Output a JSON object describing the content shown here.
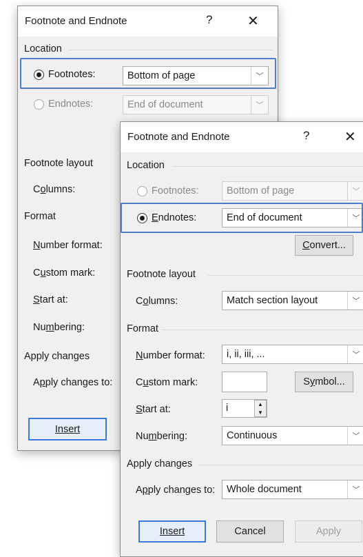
{
  "back_dialog": {
    "title": "Footnote and Endnote",
    "help": "?",
    "close": "✕",
    "location_header": "Location",
    "footnotes_label": "Footnotes:",
    "footnotes_value": "Bottom of page",
    "endnotes_label": "Endnotes:",
    "endnotes_value": "End of document",
    "footnote_layout_header": "Footnote layout",
    "columns_label": "Columns:",
    "format_header": "Format",
    "number_format_label": "Number format:",
    "custom_mark_label": "Custom mark:",
    "start_at_label": "Start at:",
    "numbering_label": "Numbering:",
    "apply_changes_header": "Apply changes",
    "apply_changes_to_label": "Apply changes to:",
    "insert_label": "Insert"
  },
  "front_dialog": {
    "title": "Footnote and Endnote",
    "help": "?",
    "close": "✕",
    "location_header": "Location",
    "footnotes_label": "Footnotes:",
    "footnotes_value": "Bottom of page",
    "endnotes_label": "Endnotes:",
    "endnotes_value": "End of document",
    "convert_label": "Convert...",
    "footnote_layout_header": "Footnote layout",
    "columns_label": "Columns:",
    "columns_value": "Match section layout",
    "format_header": "Format",
    "number_format_label": "Number format:",
    "number_format_value": "i, ii, iii, ...",
    "custom_mark_label": "Custom mark:",
    "custom_mark_value": "",
    "symbol_label": "Symbol...",
    "start_at_label": "Start at:",
    "start_at_value": "i",
    "numbering_label": "Numbering:",
    "numbering_value": "Continuous",
    "apply_changes_header": "Apply changes",
    "apply_changes_to_label": "Apply changes to:",
    "apply_changes_to_value": "Whole document",
    "insert_label": "Insert",
    "cancel_label": "Cancel",
    "apply_label": "Apply"
  },
  "colors": {
    "highlight": "#4f7bc9",
    "dialog_bg": "#f0f0f0",
    "title_bg": "#ffffff"
  }
}
